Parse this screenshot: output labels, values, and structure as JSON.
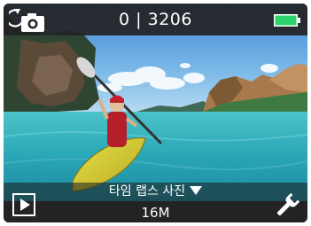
{
  "status_bar": {
    "mode_icon": "photo-mode-icon",
    "counter": "0 | 3206",
    "battery_icon": "battery-full-icon",
    "battery_color": "#2bd46b"
  },
  "preview": {
    "caption": "타임 랩스 사진",
    "caption_arrow_icon": "caret-down-icon"
  },
  "bottom_bar": {
    "playback_icon": "play-icon",
    "resolution": "16M",
    "settings_icon": "wrench-icon"
  }
}
